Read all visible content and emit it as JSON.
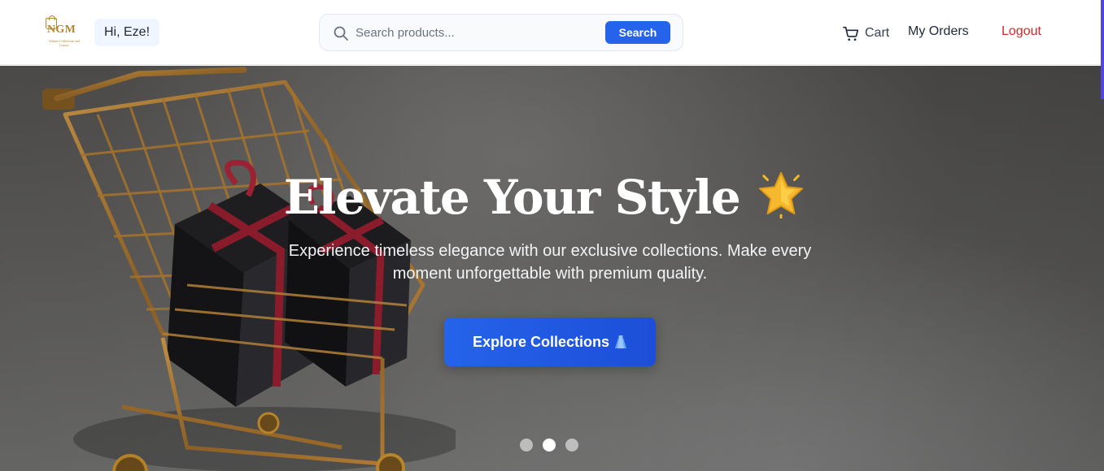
{
  "header": {
    "logo": {
      "mark": "NGM",
      "tagline": "Adaeze Collections and Luxury"
    },
    "greeting": "Hi, Eze!",
    "search": {
      "placeholder": "Search products...",
      "button_label": "Search",
      "icon": "search-icon"
    },
    "nav": {
      "cart_label": "Cart",
      "cart_icon": "cart-icon",
      "orders_label": "My Orders",
      "logout_label": "Logout"
    }
  },
  "hero": {
    "title": "Elevate Your Style",
    "title_icon": "star-icon",
    "subtitle": "Experience timeless elegance with our exclusive collections. Make every moment unforgettable with premium quality.",
    "cta_label": "Explore Collections",
    "cta_icon": "dress-icon",
    "slides": {
      "count": 3,
      "active": 2
    }
  },
  "colors": {
    "primary": "#2563eb",
    "logout": "#dc2626",
    "brand_gold": "#b8862b",
    "greeting_bg": "#eff6ff"
  }
}
